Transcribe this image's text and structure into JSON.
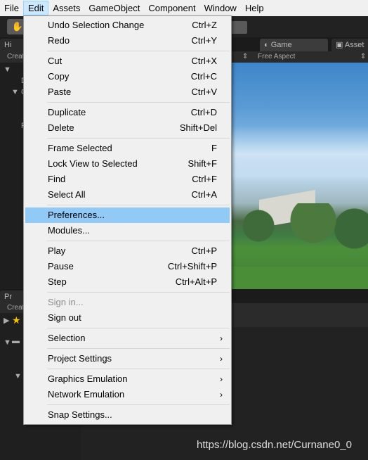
{
  "menubar": {
    "items": [
      "File",
      "Edit",
      "Assets",
      "GameObject",
      "Component",
      "Window",
      "Help"
    ],
    "active": "Edit"
  },
  "background": {
    "toolbar_fragment": "al",
    "hierarchy_tab": "Hi",
    "hierarchy_create": "Creat",
    "game_tab": "Game",
    "asset_tab": "Asset",
    "aspect": "Free Aspect",
    "project_tab": "Pr",
    "project_create": "Creat",
    "hier_fragments": [
      "D",
      "C",
      "P"
    ]
  },
  "edit_menu": {
    "items": [
      {
        "label": "Undo Selection Change",
        "shortcut": "Ctrl+Z"
      },
      {
        "label": "Redo",
        "shortcut": "Ctrl+Y"
      },
      {
        "label": "Cut",
        "shortcut": "Ctrl+X"
      },
      {
        "label": "Copy",
        "shortcut": "Ctrl+C"
      },
      {
        "label": "Paste",
        "shortcut": "Ctrl+V"
      },
      {
        "label": "Duplicate",
        "shortcut": "Ctrl+D"
      },
      {
        "label": "Delete",
        "shortcut": "Shift+Del"
      },
      {
        "label": "Frame Selected",
        "shortcut": "F"
      },
      {
        "label": "Lock View to Selected",
        "shortcut": "Shift+F"
      },
      {
        "label": "Find",
        "shortcut": "Ctrl+F"
      },
      {
        "label": "Select All",
        "shortcut": "Ctrl+A"
      },
      {
        "label": "Preferences...",
        "shortcut": ""
      },
      {
        "label": "Modules...",
        "shortcut": ""
      },
      {
        "label": "Play",
        "shortcut": "Ctrl+P"
      },
      {
        "label": "Pause",
        "shortcut": "Ctrl+Shift+P"
      },
      {
        "label": "Step",
        "shortcut": "Ctrl+Alt+P"
      },
      {
        "label": "Sign in...",
        "shortcut": ""
      },
      {
        "label": "Sign out",
        "shortcut": ""
      },
      {
        "label": "Selection",
        "shortcut": ""
      },
      {
        "label": "Project Settings",
        "shortcut": ""
      },
      {
        "label": "Graphics Emulation",
        "shortcut": ""
      },
      {
        "label": "Network Emulation",
        "shortcut": ""
      },
      {
        "label": "Snap Settings...",
        "shortcut": ""
      }
    ],
    "highlighted": "Preferences...",
    "disabled": [
      "Sign in..."
    ],
    "submenu_arrow": "›"
  },
  "watermark": "https://blog.csdn.net/Curnane0_0"
}
